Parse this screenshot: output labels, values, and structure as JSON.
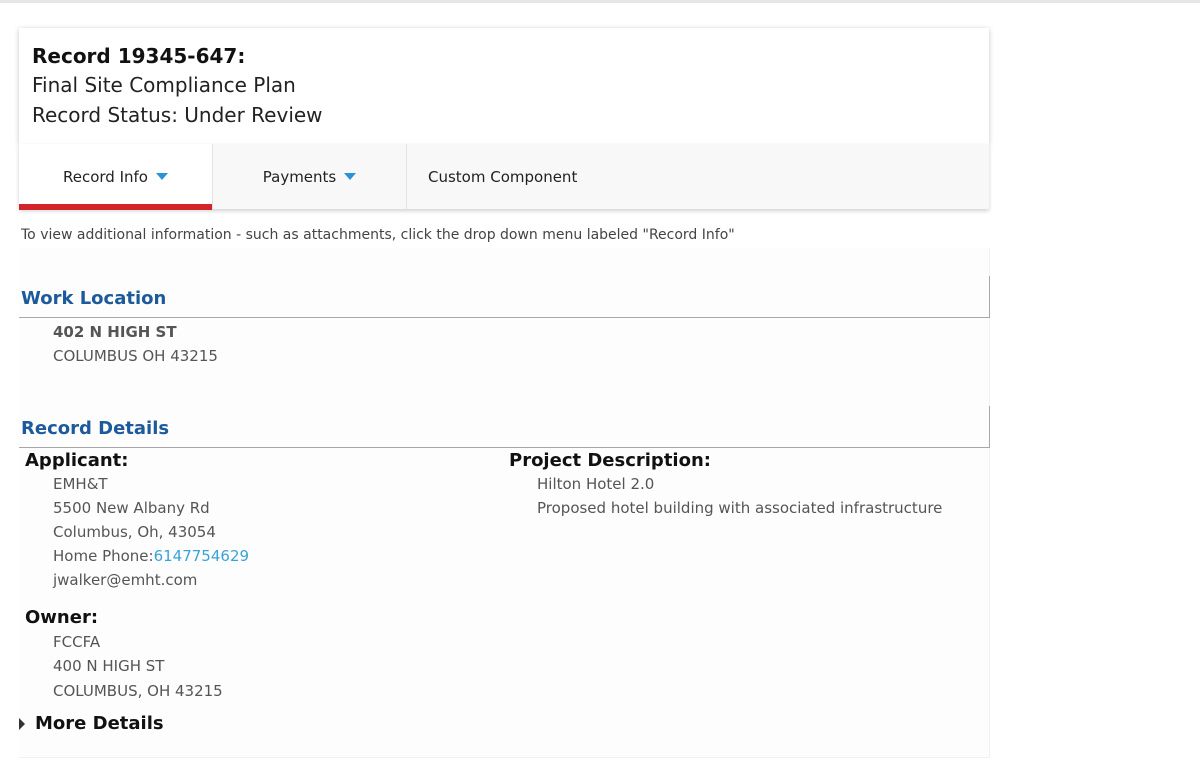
{
  "record": {
    "title": "Record 19345-647:",
    "name": "Final Site Compliance Plan",
    "status": "Record Status: Under Review"
  },
  "tabs": [
    {
      "label": "Record Info",
      "has_dropdown": true,
      "active": true
    },
    {
      "label": "Payments",
      "has_dropdown": true,
      "active": false
    },
    {
      "label": "Custom Component",
      "has_dropdown": false,
      "active": false
    }
  ],
  "help_text": "To view additional information - such as attachments, click the drop down menu labeled \"Record Info\"",
  "work_location": {
    "heading": "Work Location",
    "street": "402 N HIGH ST",
    "city_line": "COLUMBUS OH 43215"
  },
  "record_details": {
    "heading": "Record Details",
    "applicant": {
      "heading": "Applicant:",
      "name": "EMH&T",
      "address": "5500 New Albany Rd",
      "city_line": "Columbus, Oh, 43054",
      "phone_label": "Home Phone:",
      "phone": "6147754629",
      "email": "jwalker@emht.com"
    },
    "owner": {
      "heading": "Owner:",
      "name": "FCCFA",
      "address": "400 N HIGH ST",
      "city_line": "COLUMBUS, OH 43215"
    },
    "project": {
      "heading": "Project Description:",
      "name": "Hilton Hotel 2.0",
      "description": "Proposed hotel building with associated infrastructure"
    },
    "more_details": "More Details"
  },
  "colors": {
    "accent_red": "#d3242a",
    "heading_blue": "#1d5a9b",
    "link_blue": "#39a3d8",
    "caret_blue": "#2a93d8"
  },
  "icons": {
    "tab_dropdown": "caret-down-icon",
    "more_details": "triangle-right-icon"
  }
}
